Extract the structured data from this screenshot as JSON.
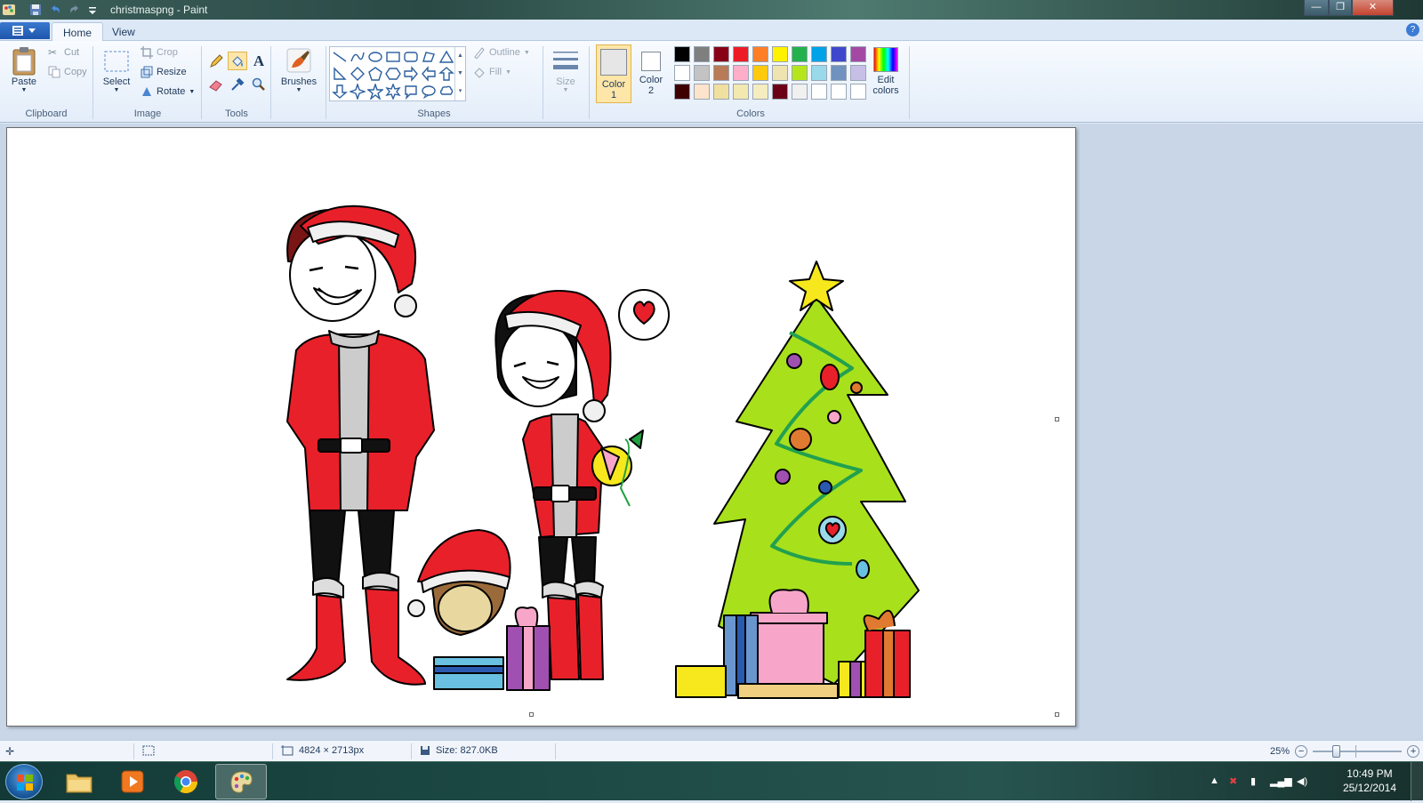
{
  "window": {
    "title": "christmaspng - Paint",
    "minimize": "—",
    "maximize": "❐",
    "close": "✕"
  },
  "tabs": [
    {
      "label": "Home",
      "active": true
    },
    {
      "label": "View",
      "active": false
    }
  ],
  "help": "?",
  "clipboard": {
    "group": "Clipboard",
    "paste": "Paste",
    "cut": "Cut",
    "copy": "Copy"
  },
  "image": {
    "group": "Image",
    "select": "Select",
    "crop": "Crop",
    "resize": "Resize",
    "rotate": "Rotate"
  },
  "tools": {
    "group": "Tools",
    "text_glyph": "A"
  },
  "brushes": {
    "label": "Brushes"
  },
  "shapes": {
    "group": "Shapes",
    "outline": "Outline",
    "fill": "Fill"
  },
  "size": {
    "label": "Size"
  },
  "colors": {
    "group": "Colors",
    "color1": "Color",
    "color1_num": "1",
    "color2": "Color",
    "color2_num": "2",
    "edit": "Edit",
    "edit2": "colors",
    "color1_value": "#e6e6e6",
    "color2_value": "#ffffff",
    "palette": [
      "#000000",
      "#7f7f7f",
      "#880015",
      "#ed1c24",
      "#ff7f27",
      "#fff200",
      "#22b14c",
      "#00a2e8",
      "#3f48cc",
      "#a349a4",
      "#ffffff",
      "#c3c3c3",
      "#b97a57",
      "#ffaec9",
      "#ffc90e",
      "#efe4b0",
      "#b5e61d",
      "#99d9ea",
      "#7092be",
      "#c8bfe7",
      "#3f0000",
      "#ffe4cc",
      "#f0e0a0",
      "#f2e8b0",
      "#f5edc0",
      "#6b0016",
      "#f0f0f0",
      "#ffffff",
      "#ffffff",
      "#ffffff"
    ]
  },
  "status": {
    "dimensions": "4824 × 2713px",
    "size": "Size: 827.0KB",
    "zoom": "25%"
  },
  "taskbar": {
    "time": "10:49 PM",
    "date": "25/12/2014"
  }
}
